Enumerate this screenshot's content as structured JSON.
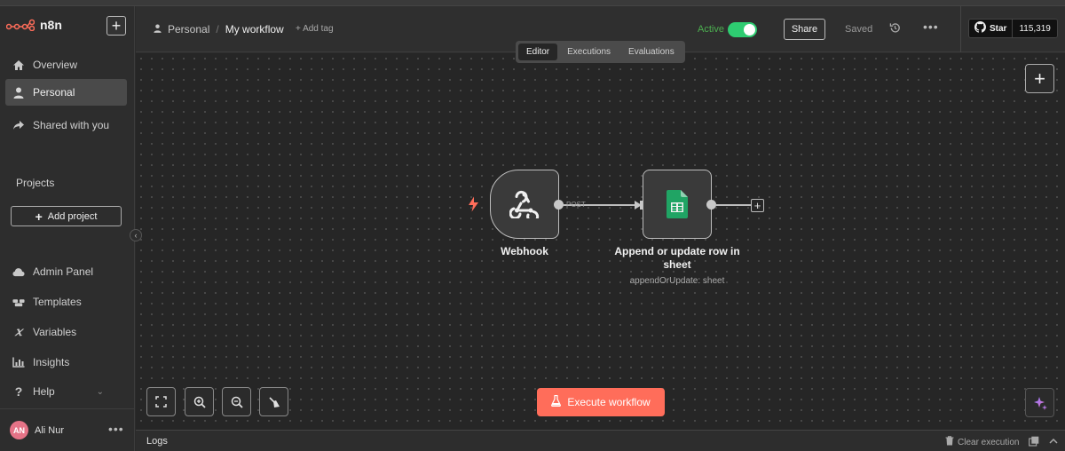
{
  "app": {
    "logo_text": "n8n",
    "brand_color": "#ff6d5a"
  },
  "sidebar": {
    "new_button_label": "+",
    "nav_top": [
      {
        "label": "Overview",
        "icon": "home-icon"
      },
      {
        "label": "Personal",
        "icon": "user-icon",
        "active": true
      },
      {
        "label": "Shared with you",
        "icon": "share-icon"
      }
    ],
    "projects_title": "Projects",
    "add_project_label": "Add project",
    "nav_bottom": [
      {
        "label": "Admin Panel",
        "icon": "cloud-icon"
      },
      {
        "label": "Templates",
        "icon": "templates-icon"
      },
      {
        "label": "Variables",
        "icon": "variables-icon"
      },
      {
        "label": "Insights",
        "icon": "chart-icon"
      },
      {
        "label": "Help",
        "icon": "help-icon"
      }
    ],
    "user": {
      "initials": "AN",
      "name": "Ali Nur",
      "menu": "•••"
    }
  },
  "header": {
    "breadcrumb_parent": "Personal",
    "breadcrumb_separator": "/",
    "workflow_name": "My workflow",
    "add_tag_label": "+ Add tag",
    "active_label": "Active",
    "active_state": true,
    "share_label": "Share",
    "saved_label": "Saved",
    "more_label": "•••",
    "github": {
      "star_label": "Star",
      "star_count": "115,319"
    }
  },
  "tabs": [
    {
      "label": "Editor",
      "active": true
    },
    {
      "label": "Executions",
      "active": false
    },
    {
      "label": "Evaluations",
      "active": false
    }
  ],
  "canvas": {
    "nodes": [
      {
        "title": "Webhook",
        "subtitle": ""
      },
      {
        "title_line1": "Append or update row in",
        "title_line2": "sheet",
        "subtitle": "appendOrUpdate: sheet"
      }
    ],
    "connection_label": "POST",
    "execute_label": "Execute workflow"
  },
  "logs": {
    "label": "Logs",
    "clear_label": "Clear execution"
  }
}
